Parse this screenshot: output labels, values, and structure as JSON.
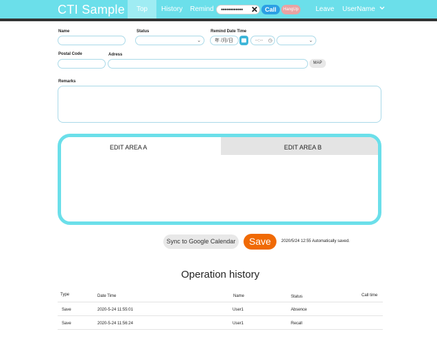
{
  "header": {
    "app_title": "CTI Sample",
    "nav": [
      "Top",
      "History",
      "Remind"
    ],
    "phone_masked": "••••••••••••",
    "clear_symbol": "✕",
    "call_label": "Call",
    "hangup_label": "HangUp",
    "leave_label": "Leave",
    "user_label": "UserName",
    "accent_color": "#6bdfea"
  },
  "form": {
    "name_label": "Name",
    "status_label": "Status",
    "remind_label": "Remind Date Time",
    "date_placeholder": "年 /月/日",
    "time_placeholder": "--:--",
    "postal_label": "Postal Code",
    "address_label": "Adress",
    "map_label": "MAP",
    "remarks_label": "Remarks"
  },
  "edit_areas": {
    "tab_a": "EDIT AREA A",
    "tab_b": "EDIT AREA B"
  },
  "actions": {
    "sync_label": "Sync to Google Calendar",
    "save_label": "Save",
    "autosave_text": "2020/5/24 12:55 Automatically saved."
  },
  "history": {
    "title": "Operation history",
    "columns": [
      "Type",
      "Date Time",
      "Name",
      "Status",
      "Call time"
    ],
    "rows": [
      [
        "Save",
        "2020-5-24 11:55:01",
        "User1",
        "Absence",
        ""
      ],
      [
        "Save",
        "2020-5-24 11:56:24",
        "User1",
        "Recall",
        ""
      ]
    ]
  }
}
